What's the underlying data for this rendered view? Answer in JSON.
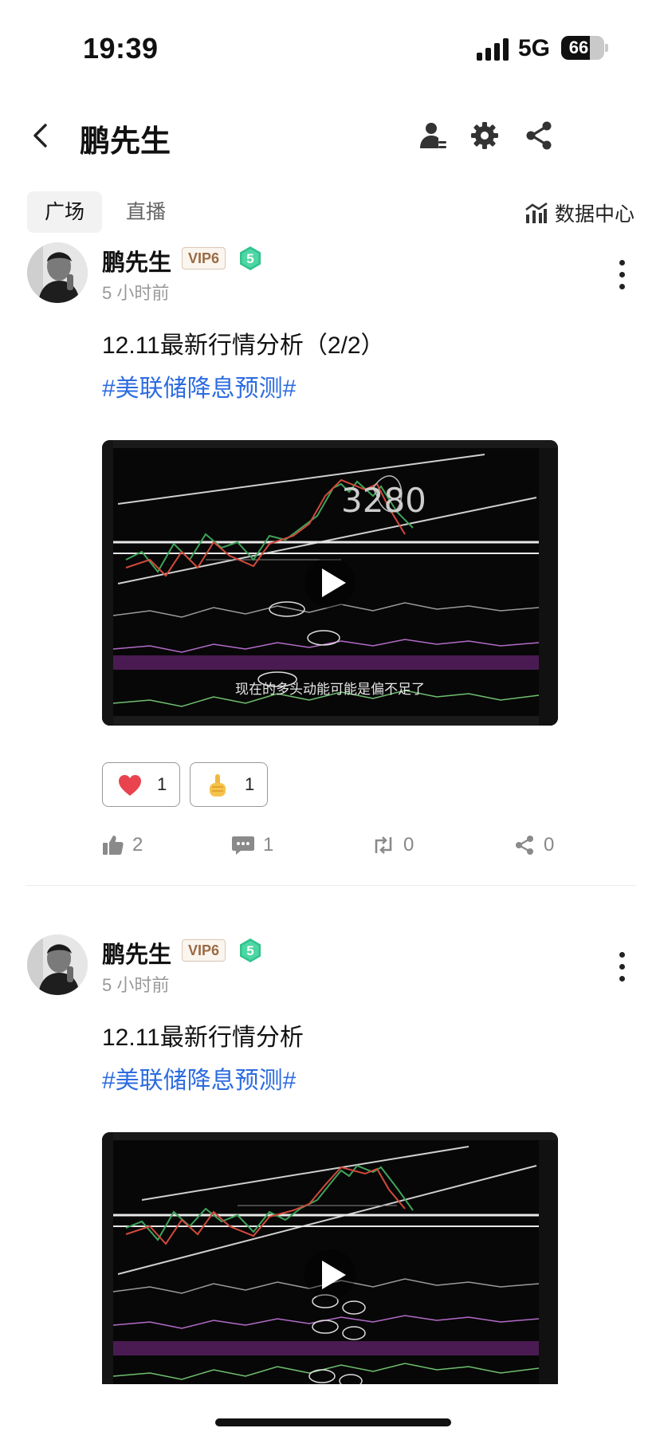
{
  "status_bar": {
    "time": "19:39",
    "network": "5G",
    "battery": "66",
    "battery_level": 0.66
  },
  "nav": {
    "title": "鹏先生",
    "icons": [
      "back-icon",
      "user-manage-icon",
      "gear-icon",
      "share-icon"
    ]
  },
  "tabs": [
    {
      "label": "广场",
      "active": true
    },
    {
      "label": "直播",
      "active": false
    }
  ],
  "data_center": {
    "label": "数据中心",
    "icon": "chart-icon"
  },
  "posts": [
    {
      "author": "鹏先生",
      "vip": "VIP6",
      "level": "5",
      "time": "5 小时前",
      "title": "12.11最新行情分析（2/2）",
      "tag": "#美联储降息预测#",
      "video_subtitle": "现在的多头动能可能是偏不足了",
      "reactions": [
        {
          "emoji": "heart-icon",
          "count": "1"
        },
        {
          "emoji": "thumbs-up-emoji-icon",
          "count": "1"
        }
      ],
      "likes": "2",
      "comments": "1",
      "reposts": "0",
      "shares": "0"
    },
    {
      "author": "鹏先生",
      "vip": "VIP6",
      "level": "5",
      "time": "5 小时前",
      "title": "12.11最新行情分析",
      "tag": "#美联储降息预测#"
    }
  ],
  "colors": {
    "tag": "#2d6ce0",
    "vip_text": "#9a6b45",
    "level_badge": "#2fc38f",
    "heart": "#e8434f"
  }
}
